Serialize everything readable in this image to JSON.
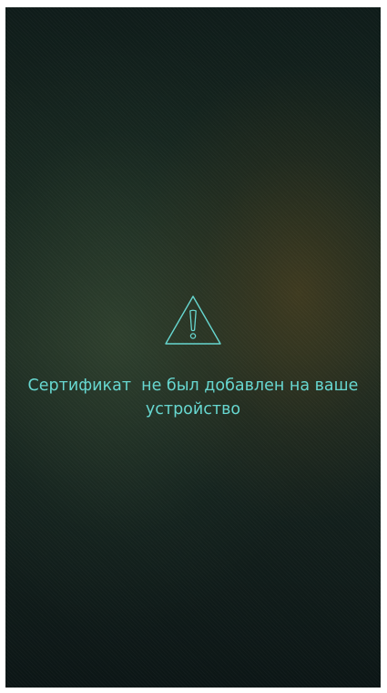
{
  "error": {
    "icon": "warning-triangle-icon",
    "message": "Сертификат  не был добавлен на ваше устройство"
  },
  "colors": {
    "accent": "#67d7d0"
  }
}
